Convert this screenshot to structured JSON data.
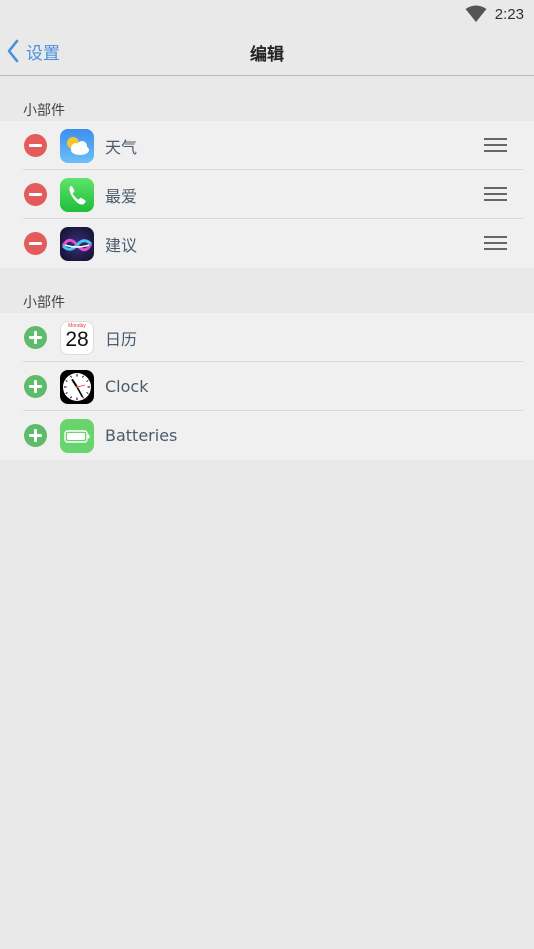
{
  "status": {
    "time": "2:23"
  },
  "nav": {
    "back_label": "设置",
    "title": "编辑"
  },
  "sections": [
    {
      "header": "小部件",
      "items": [
        {
          "label": "天气",
          "icon": "weather-icon"
        },
        {
          "label": "最爱",
          "icon": "phone-icon"
        },
        {
          "label": "建议",
          "icon": "siri-icon"
        }
      ]
    },
    {
      "header": "小部件",
      "items": [
        {
          "label": "日历",
          "icon": "calendar-icon",
          "calendar_day": "28",
          "calendar_weekday": "Monday"
        },
        {
          "label": "Clock",
          "icon": "clock-icon"
        },
        {
          "label": "Batteries",
          "icon": "battery-icon"
        }
      ]
    }
  ],
  "colors": {
    "remove": "#e55a5a",
    "add": "#5dbb6a",
    "accent": "#4a8fe0"
  }
}
